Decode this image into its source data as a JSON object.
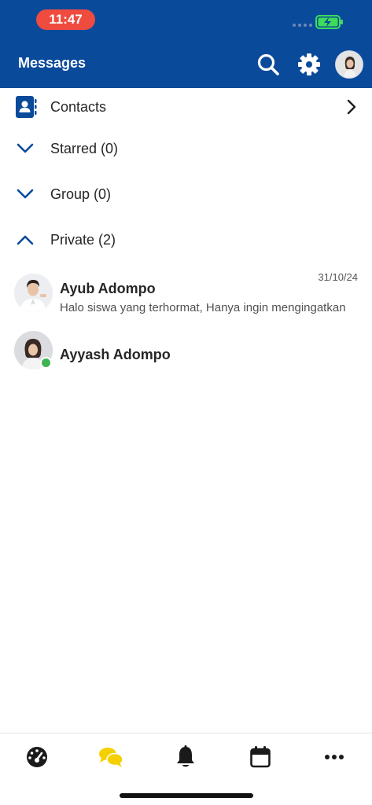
{
  "status_bar": {
    "time": "11:47"
  },
  "header": {
    "title": "Messages"
  },
  "sections": [
    {
      "label": "Contacts",
      "icon": "contacts-book-icon"
    },
    {
      "label": "Starred (0)",
      "icon": "chevron-down-icon"
    },
    {
      "label": "Group (0)",
      "icon": "chevron-down-icon"
    },
    {
      "label": "Private (2)",
      "icon": "chevron-up-icon"
    }
  ],
  "conversations": [
    {
      "name": "Ayub Adompo",
      "preview": "Halo siswa yang terhormat, Hanya ingin mengingatkan",
      "date": "31/10/24"
    },
    {
      "name": "Ayyash Adompo",
      "status": "online"
    }
  ],
  "tabs": [
    "dashboard-icon",
    "chat-bubbles-icon",
    "bell-icon",
    "calendar-icon",
    "more-icon"
  ],
  "colors": {
    "header": "#0a4a9b",
    "accent": "#0a4a9b",
    "active_tab": "#f5d000",
    "online": "#3fb44f",
    "time_pill": "#ef4b3f"
  }
}
